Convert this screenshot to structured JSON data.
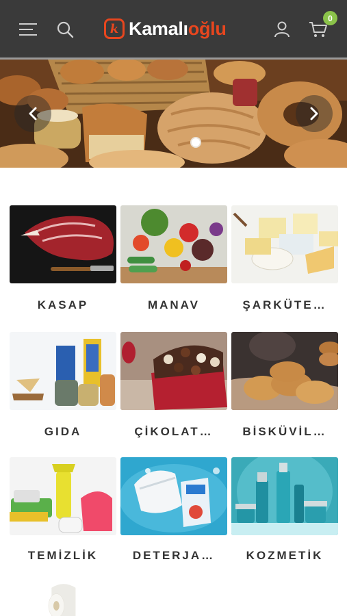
{
  "header": {
    "logo_text_main": "Kamalı",
    "logo_text_accent": "oğlu",
    "logo_mark": "k",
    "cart_count": "0",
    "icons": [
      "menu-icon",
      "search-icon",
      "user-icon",
      "cart-icon"
    ]
  },
  "slider": {
    "image": "bakery-bread-assortment",
    "dots": 1,
    "active_dot": 1
  },
  "categories": [
    {
      "label": "KASAP",
      "image": "raw-meat"
    },
    {
      "label": "MANAV",
      "image": "fresh-vegetables"
    },
    {
      "label": "ŞARKÜTE…",
      "image": "cheese-selection"
    },
    {
      "label": "GIDA",
      "image": "dry-food-packages"
    },
    {
      "label": "ÇİKOLAT…",
      "image": "chocolate-box"
    },
    {
      "label": "BİSKÜVİL…",
      "image": "cookies"
    },
    {
      "label": "TEMİZLİK",
      "image": "cleaning-supplies"
    },
    {
      "label": "DETERJA…",
      "image": "laundry-detergent"
    },
    {
      "label": "KOZMETİK",
      "image": "cosmetic-bottles"
    },
    {
      "label": "",
      "image": "toilet-paper-roll"
    }
  ],
  "colors": {
    "header_bg": "#3a3a3a",
    "brand_orange": "#e8461e",
    "badge_green": "#8bc34a",
    "label_text": "#333333"
  }
}
